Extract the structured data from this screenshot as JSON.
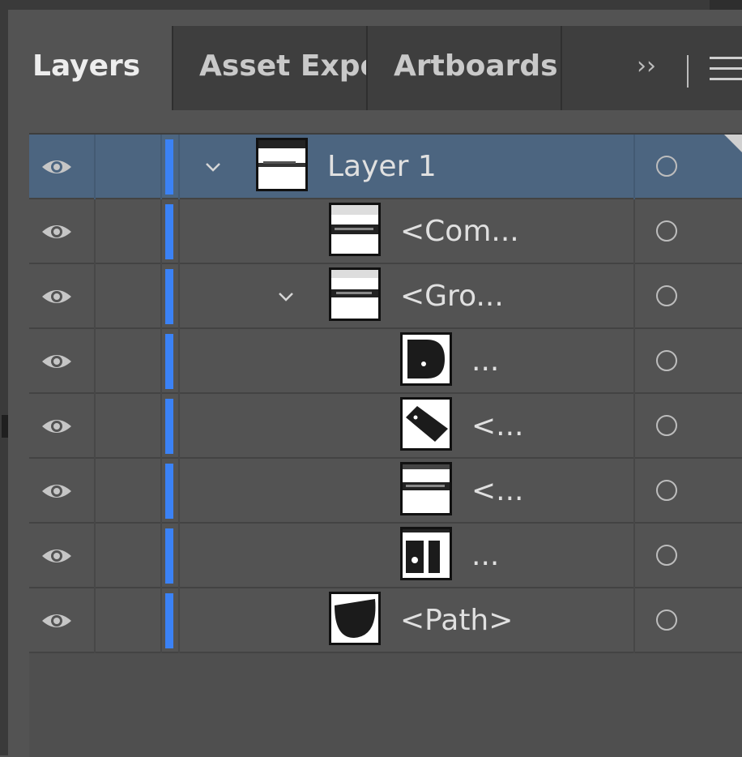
{
  "tabs": [
    {
      "label": "Layers",
      "active": true
    },
    {
      "label": "Asset Expo",
      "active": false
    },
    {
      "label": "Artboards",
      "active": false
    }
  ],
  "tab_overflow": "››",
  "accent_color": "#3b82f6",
  "selected_row_color": "#4c6580",
  "layers": [
    {
      "label": "Layer 1",
      "depth": 0,
      "expanded": true,
      "selected": true,
      "thumb": "bar-icon"
    },
    {
      "label": "<Com...",
      "depth": 1,
      "expanded": false,
      "selected": false,
      "thumb": "bar-icon"
    },
    {
      "label": "<Gro...",
      "depth": 1,
      "expanded": true,
      "selected": false,
      "thumb": "bar-icon"
    },
    {
      "label": "...",
      "depth": 2,
      "expanded": false,
      "selected": false,
      "thumb": "d-shape-icon"
    },
    {
      "label": "<...",
      "depth": 2,
      "expanded": false,
      "selected": false,
      "thumb": "tilted-rect-icon"
    },
    {
      "label": "<...",
      "depth": 2,
      "expanded": false,
      "selected": false,
      "thumb": "bar-icon"
    },
    {
      "label": "...",
      "depth": 2,
      "expanded": false,
      "selected": false,
      "thumb": "glyph-icon"
    },
    {
      "label": "<Path>",
      "depth": 1,
      "expanded": false,
      "selected": false,
      "thumb": "half-circle-icon"
    }
  ]
}
